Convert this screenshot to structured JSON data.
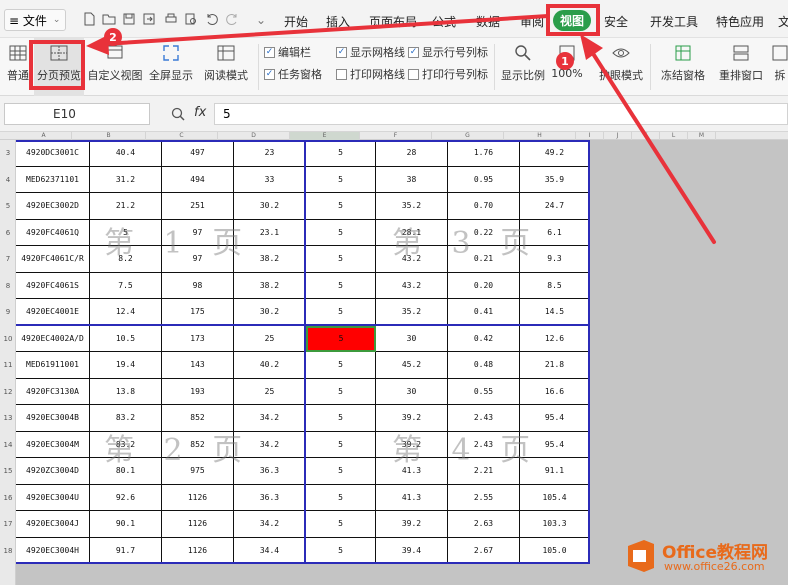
{
  "menubar": {
    "file_label": "≡ 文件",
    "tabs": [
      "开始",
      "插入",
      "页面布局",
      "公式",
      "数据",
      "审阅",
      "视图",
      "安全",
      "开发工具",
      "特色应用",
      "文"
    ],
    "active_tab": "视图"
  },
  "ribbon": {
    "normal": "普通",
    "page_break_preview": "分页预览",
    "custom_view": "自定义视图",
    "full_screen": "全屏显示",
    "reading_mode": "阅读模式",
    "edit_bar": "编辑栏",
    "task_pane": "任务窗格",
    "show_gridlines": "显示网格线",
    "print_gridlines": "打印网格线",
    "show_headers": "显示行号列标",
    "print_headers": "打印行号列标",
    "zoom": "显示比例",
    "zoom_100": "100%",
    "eye_mode": "护眼模式",
    "freeze": "冻结窗格",
    "arrange": "重排窗口",
    "split": "拆"
  },
  "formula_bar": {
    "cell_ref": "E10",
    "fx": "fx",
    "value": "5"
  },
  "columns": [
    "A",
    "B",
    "C",
    "D",
    "E",
    "F",
    "G",
    "H",
    "I",
    "J",
    "K",
    "L",
    "M"
  ],
  "rows": [
    {
      "n": "3",
      "cells": [
        "4920DC3001C",
        "40.4",
        "497",
        "23",
        "5",
        "28",
        "1.76",
        "49.2"
      ]
    },
    {
      "n": "4",
      "cells": [
        "MED62371101",
        "31.2",
        "494",
        "33",
        "5",
        "38",
        "0.95",
        "35.9"
      ]
    },
    {
      "n": "5",
      "cells": [
        "4920EC3002D",
        "21.2",
        "251",
        "30.2",
        "5",
        "35.2",
        "0.70",
        "24.7"
      ]
    },
    {
      "n": "6",
      "cells": [
        "4920FC4061Q",
        "5",
        "97",
        "23.1",
        "5",
        "28.1",
        "0.22",
        "6.1"
      ]
    },
    {
      "n": "7",
      "cells": [
        "4920FC4061C/R",
        "8.2",
        "97",
        "38.2",
        "5",
        "43.2",
        "0.21",
        "9.3"
      ]
    },
    {
      "n": "8",
      "cells": [
        "4920FC4061S",
        "7.5",
        "98",
        "38.2",
        "5",
        "43.2",
        "0.20",
        "8.5"
      ]
    },
    {
      "n": "9",
      "cells": [
        "4920EC4001E",
        "12.4",
        "175",
        "30.2",
        "5",
        "35.2",
        "0.41",
        "14.5"
      ]
    },
    {
      "n": "10",
      "cells": [
        "4920EC4002A/D",
        "10.5",
        "173",
        "25",
        "5",
        "30",
        "0.42",
        "12.6"
      ]
    },
    {
      "n": "11",
      "cells": [
        "MED61911001",
        "19.4",
        "143",
        "40.2",
        "5",
        "45.2",
        "0.48",
        "21.8"
      ]
    },
    {
      "n": "12",
      "cells": [
        "4920FC3130A",
        "13.8",
        "193",
        "25",
        "5",
        "30",
        "0.55",
        "16.6"
      ]
    },
    {
      "n": "13",
      "cells": [
        "4920EC3004B",
        "83.2",
        "852",
        "34.2",
        "5",
        "39.2",
        "2.43",
        "95.4"
      ]
    },
    {
      "n": "14",
      "cells": [
        "4920EC3004M",
        "83.2",
        "852",
        "34.2",
        "5",
        "39.2",
        "2.43",
        "95.4"
      ]
    },
    {
      "n": "15",
      "cells": [
        "4920ZC3004D",
        "80.1",
        "975",
        "36.3",
        "5",
        "41.3",
        "2.21",
        "91.1"
      ]
    },
    {
      "n": "16",
      "cells": [
        "4920EC3004U",
        "92.6",
        "1126",
        "36.3",
        "5",
        "41.3",
        "2.55",
        "105.4"
      ]
    },
    {
      "n": "17",
      "cells": [
        "4920EC3004J",
        "90.1",
        "1126",
        "34.2",
        "5",
        "39.2",
        "2.63",
        "103.3"
      ]
    },
    {
      "n": "18",
      "cells": [
        "4920EC3004H",
        "91.7",
        "1126",
        "34.4",
        "5",
        "39.4",
        "2.67",
        "105.0"
      ]
    }
  ],
  "selected": {
    "row": "10",
    "col": "E"
  },
  "watermarks": {
    "p1": "第 1 页",
    "p2": "第 2 页",
    "p3": "第 3 页",
    "p4": "第 4 页"
  },
  "annotations": {
    "badge1": "1",
    "badge2": "2"
  },
  "logo": {
    "title": "Office教程网",
    "url": "www.office26.com"
  },
  "colors": {
    "active_tab": "#2a9d4a",
    "annotation": "#e8323a",
    "page_break": "#2b2bb8",
    "selected_cell": "#ff0000",
    "logo": "#e86a1b"
  }
}
